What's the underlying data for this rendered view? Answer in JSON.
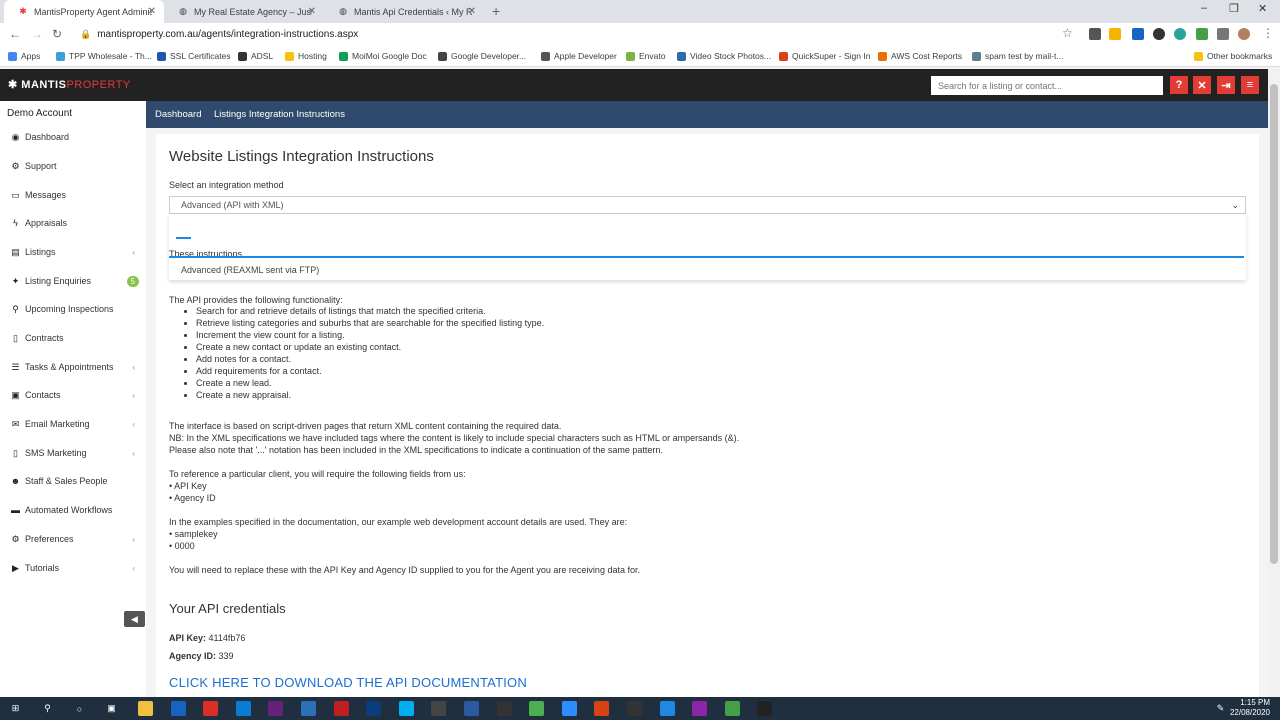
{
  "browser": {
    "tabs": [
      {
        "title": "MantisProperty Agent Administra",
        "close": "✕"
      },
      {
        "title": "My Real Estate Agency – Just ano",
        "close": "✕"
      },
      {
        "title": "Mantis Api Credentials ‹ My Real",
        "close": "✕"
      }
    ],
    "new_tab": "+",
    "url": "mantisproperty.com.au/agents/integration-instructions.aspx",
    "bookmarks": [
      {
        "label": "Apps",
        "color": "#4285f4"
      },
      {
        "label": "TPP Wholesale - Th...",
        "color": "#3aa0d8"
      },
      {
        "label": "SSL Certificates",
        "color": "#1a5aa8"
      },
      {
        "label": "ADSL",
        "color": "#333333"
      },
      {
        "label": "Hosting",
        "color": "#f4c20d"
      },
      {
        "label": "MoiMoi Google Doc",
        "color": "#0f9d58"
      },
      {
        "label": "Google Developer...",
        "color": "#444444"
      },
      {
        "label": "Apple Developer",
        "color": "#555555"
      },
      {
        "label": "Envato",
        "color": "#7cb342"
      },
      {
        "label": "Video Stock Photos...",
        "color": "#2b6cb0"
      },
      {
        "label": "QuickSuper - Sign In",
        "color": "#d84315"
      },
      {
        "label": "AWS Cost Reports",
        "color": "#ef6c00"
      },
      {
        "label": "spam test by mail-t...",
        "color": "#607d8b"
      }
    ],
    "other_bookmarks": "Other bookmarks"
  },
  "header": {
    "logo_main": "MANTIS",
    "logo_accent": "PROPERTY",
    "search_placeholder": "Search for a listing or contact...",
    "buttons": [
      "?",
      "✕",
      "⇥",
      "≡"
    ]
  },
  "sidebar": {
    "account": "Demo Account",
    "items": [
      {
        "label": "Dashboard",
        "icon": "dashboard-icon",
        "glyph": "◉"
      },
      {
        "label": "Support",
        "icon": "support-icon",
        "glyph": "⚙"
      },
      {
        "label": "Messages",
        "icon": "messages-icon",
        "glyph": "▭"
      },
      {
        "label": "Appraisals",
        "icon": "appraisals-icon",
        "glyph": "ϟ"
      },
      {
        "label": "Listings",
        "icon": "listings-icon",
        "glyph": "▤",
        "chevron": "‹"
      },
      {
        "label": "Listing Enquiries",
        "icon": "enquiries-icon",
        "glyph": "✦",
        "badge": "5"
      },
      {
        "label": "Upcoming Inspections",
        "icon": "inspections-icon",
        "glyph": "⚲"
      },
      {
        "label": "Contracts",
        "icon": "contracts-icon",
        "glyph": "▯"
      },
      {
        "label": "Tasks & Appointments",
        "icon": "tasks-icon",
        "glyph": "☰",
        "chevron": "‹"
      },
      {
        "label": "Contacts",
        "icon": "contacts-icon",
        "glyph": "▣",
        "chevron": "‹"
      },
      {
        "label": "Email Marketing",
        "icon": "email-icon",
        "glyph": "✉",
        "chevron": "‹"
      },
      {
        "label": "SMS Marketing",
        "icon": "sms-icon",
        "glyph": "▯",
        "chevron": "‹"
      },
      {
        "label": "Staff & Sales People",
        "icon": "staff-icon",
        "glyph": "☻"
      },
      {
        "label": "Automated Workflows",
        "icon": "workflows-icon",
        "glyph": "▬"
      },
      {
        "label": "Preferences",
        "icon": "preferences-icon",
        "glyph": "⚙",
        "chevron": "‹"
      },
      {
        "label": "Tutorials",
        "icon": "tutorials-icon",
        "glyph": "▶",
        "chevron": "‹"
      }
    ]
  },
  "breadcrumb": {
    "home": "Dashboard",
    "current": "Listings Integration Instructions"
  },
  "page": {
    "title": "Website Listings Integration Instructions",
    "select_label": "Select an integration method",
    "select_value": "Advanced (API with XML)",
    "dropdown_last_option": "Advanced (REAXML sent via FTP)",
    "dropdown_ghost_text": "These instructions",
    "functionality_intro": "The API provides the following functionality:",
    "functions": [
      "Search for and retrieve details of listings that match the specified criteria.",
      "Retrieve listing categories and suburbs that are searchable for the specified listing type.",
      "Increment the view count for a listing.",
      "Create a new contact or update an existing contact.",
      "Add notes for a contact.",
      "Add requirements for a contact.",
      "Create a new lead.",
      "Create a new appraisal."
    ],
    "para1_line1": "The interface is based on script-driven pages that return XML content containing the required data.",
    "para1_line2": "NB: In the XML specifications we have included tags where the content is likely to include special characters such as HTML or ampersands (&).",
    "para1_line3": "Please also note that '...' notation has been included in the XML specifications to indicate a continuation of the same pattern.",
    "para2_intro": "To reference a particular client, you will require the following fields from us:",
    "para2_item1": "• API Key",
    "para2_item2": "• Agency ID",
    "para3_intro": "In the examples specified in the documentation, our example web development account details are used. They are:",
    "para3_item1": "• samplekey",
    "para3_item2": "• 0000",
    "para4": "You will need to replace these with the API Key and Agency ID supplied to you for the Agent you are receiving data for.",
    "credentials_title": "Your API credentials",
    "api_key_label": "API Key:",
    "api_key_value": "4114fb76",
    "agency_id_label": "Agency ID:",
    "agency_id_value": "339",
    "download_link": "CLICK HERE TO DOWNLOAD THE API DOCUMENTATION"
  },
  "taskbar": {
    "time": "1:15 PM",
    "date": "22/08/2020",
    "apps": [
      {
        "name": "file-explorer-icon",
        "color": "#f0c040"
      },
      {
        "name": "outlook-icon",
        "color": "#1565c0"
      },
      {
        "name": "chrome-icon",
        "color": "#d93025"
      },
      {
        "name": "edge-icon",
        "color": "#0a7cd6"
      },
      {
        "name": "visual-studio-icon",
        "color": "#68217a"
      },
      {
        "name": "app-icon",
        "color": "#2d6fb8"
      },
      {
        "name": "filezilla-icon",
        "color": "#bf1f1f"
      },
      {
        "name": "photoshop-icon",
        "color": "#0a3d7a"
      },
      {
        "name": "skype-icon",
        "color": "#00aff0"
      },
      {
        "name": "calculator-icon",
        "color": "#444444"
      },
      {
        "name": "app2-icon",
        "color": "#2c5aa0"
      },
      {
        "name": "terminal-icon",
        "color": "#333333"
      },
      {
        "name": "app3-icon",
        "color": "#4caf50"
      },
      {
        "name": "zoom-icon",
        "color": "#2d8cff"
      },
      {
        "name": "app4-icon",
        "color": "#d84315"
      },
      {
        "name": "app5-icon",
        "color": "#333333"
      },
      {
        "name": "app6-icon",
        "color": "#1e88e5"
      },
      {
        "name": "app7-icon",
        "color": "#8e24aa"
      },
      {
        "name": "app8-icon",
        "color": "#43a047"
      },
      {
        "name": "app9-icon",
        "color": "#222222"
      }
    ]
  }
}
